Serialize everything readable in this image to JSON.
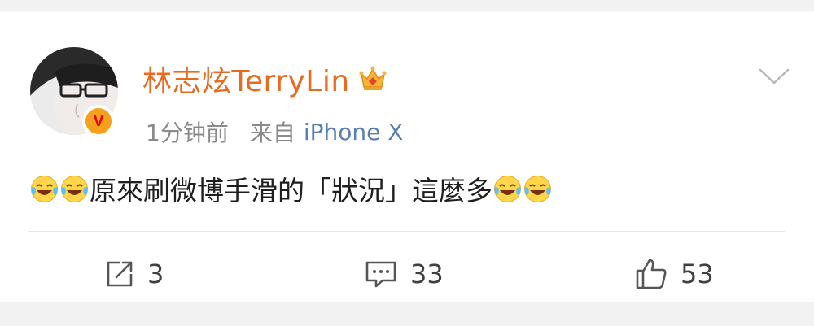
{
  "post": {
    "author": "林志炫TerryLin",
    "time": "1分钟前",
    "source_label": "来自",
    "device": "iPhone X",
    "verified_mark": "V",
    "text": "原來刷微博手滑的「狀況」這麼多",
    "emoji_name": "laughing-crying-emoji"
  },
  "actions": {
    "shares": "3",
    "comments": "33",
    "likes": "53"
  },
  "colors": {
    "username": "#e86b22",
    "device_link": "#5c7fb2",
    "meta": "#8a8a8a",
    "badge": "#f5a11c"
  }
}
